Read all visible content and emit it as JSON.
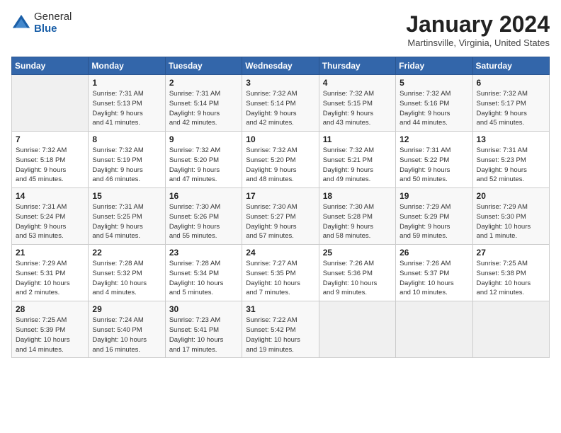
{
  "header": {
    "logo_general": "General",
    "logo_blue": "Blue",
    "month_title": "January 2024",
    "location": "Martinsville, Virginia, United States"
  },
  "days_of_week": [
    "Sunday",
    "Monday",
    "Tuesday",
    "Wednesday",
    "Thursday",
    "Friday",
    "Saturday"
  ],
  "weeks": [
    [
      {
        "day": "",
        "info": ""
      },
      {
        "day": "1",
        "info": "Sunrise: 7:31 AM\nSunset: 5:13 PM\nDaylight: 9 hours\nand 41 minutes."
      },
      {
        "day": "2",
        "info": "Sunrise: 7:31 AM\nSunset: 5:14 PM\nDaylight: 9 hours\nand 42 minutes."
      },
      {
        "day": "3",
        "info": "Sunrise: 7:32 AM\nSunset: 5:14 PM\nDaylight: 9 hours\nand 42 minutes."
      },
      {
        "day": "4",
        "info": "Sunrise: 7:32 AM\nSunset: 5:15 PM\nDaylight: 9 hours\nand 43 minutes."
      },
      {
        "day": "5",
        "info": "Sunrise: 7:32 AM\nSunset: 5:16 PM\nDaylight: 9 hours\nand 44 minutes."
      },
      {
        "day": "6",
        "info": "Sunrise: 7:32 AM\nSunset: 5:17 PM\nDaylight: 9 hours\nand 45 minutes."
      }
    ],
    [
      {
        "day": "7",
        "info": "Sunrise: 7:32 AM\nSunset: 5:18 PM\nDaylight: 9 hours\nand 45 minutes."
      },
      {
        "day": "8",
        "info": "Sunrise: 7:32 AM\nSunset: 5:19 PM\nDaylight: 9 hours\nand 46 minutes."
      },
      {
        "day": "9",
        "info": "Sunrise: 7:32 AM\nSunset: 5:20 PM\nDaylight: 9 hours\nand 47 minutes."
      },
      {
        "day": "10",
        "info": "Sunrise: 7:32 AM\nSunset: 5:20 PM\nDaylight: 9 hours\nand 48 minutes."
      },
      {
        "day": "11",
        "info": "Sunrise: 7:32 AM\nSunset: 5:21 PM\nDaylight: 9 hours\nand 49 minutes."
      },
      {
        "day": "12",
        "info": "Sunrise: 7:31 AM\nSunset: 5:22 PM\nDaylight: 9 hours\nand 50 minutes."
      },
      {
        "day": "13",
        "info": "Sunrise: 7:31 AM\nSunset: 5:23 PM\nDaylight: 9 hours\nand 52 minutes."
      }
    ],
    [
      {
        "day": "14",
        "info": "Sunrise: 7:31 AM\nSunset: 5:24 PM\nDaylight: 9 hours\nand 53 minutes."
      },
      {
        "day": "15",
        "info": "Sunrise: 7:31 AM\nSunset: 5:25 PM\nDaylight: 9 hours\nand 54 minutes."
      },
      {
        "day": "16",
        "info": "Sunrise: 7:30 AM\nSunset: 5:26 PM\nDaylight: 9 hours\nand 55 minutes."
      },
      {
        "day": "17",
        "info": "Sunrise: 7:30 AM\nSunset: 5:27 PM\nDaylight: 9 hours\nand 57 minutes."
      },
      {
        "day": "18",
        "info": "Sunrise: 7:30 AM\nSunset: 5:28 PM\nDaylight: 9 hours\nand 58 minutes."
      },
      {
        "day": "19",
        "info": "Sunrise: 7:29 AM\nSunset: 5:29 PM\nDaylight: 9 hours\nand 59 minutes."
      },
      {
        "day": "20",
        "info": "Sunrise: 7:29 AM\nSunset: 5:30 PM\nDaylight: 10 hours\nand 1 minute."
      }
    ],
    [
      {
        "day": "21",
        "info": "Sunrise: 7:29 AM\nSunset: 5:31 PM\nDaylight: 10 hours\nand 2 minutes."
      },
      {
        "day": "22",
        "info": "Sunrise: 7:28 AM\nSunset: 5:32 PM\nDaylight: 10 hours\nand 4 minutes."
      },
      {
        "day": "23",
        "info": "Sunrise: 7:28 AM\nSunset: 5:34 PM\nDaylight: 10 hours\nand 5 minutes."
      },
      {
        "day": "24",
        "info": "Sunrise: 7:27 AM\nSunset: 5:35 PM\nDaylight: 10 hours\nand 7 minutes."
      },
      {
        "day": "25",
        "info": "Sunrise: 7:26 AM\nSunset: 5:36 PM\nDaylight: 10 hours\nand 9 minutes."
      },
      {
        "day": "26",
        "info": "Sunrise: 7:26 AM\nSunset: 5:37 PM\nDaylight: 10 hours\nand 10 minutes."
      },
      {
        "day": "27",
        "info": "Sunrise: 7:25 AM\nSunset: 5:38 PM\nDaylight: 10 hours\nand 12 minutes."
      }
    ],
    [
      {
        "day": "28",
        "info": "Sunrise: 7:25 AM\nSunset: 5:39 PM\nDaylight: 10 hours\nand 14 minutes."
      },
      {
        "day": "29",
        "info": "Sunrise: 7:24 AM\nSunset: 5:40 PM\nDaylight: 10 hours\nand 16 minutes."
      },
      {
        "day": "30",
        "info": "Sunrise: 7:23 AM\nSunset: 5:41 PM\nDaylight: 10 hours\nand 17 minutes."
      },
      {
        "day": "31",
        "info": "Sunrise: 7:22 AM\nSunset: 5:42 PM\nDaylight: 10 hours\nand 19 minutes."
      },
      {
        "day": "",
        "info": ""
      },
      {
        "day": "",
        "info": ""
      },
      {
        "day": "",
        "info": ""
      }
    ]
  ]
}
